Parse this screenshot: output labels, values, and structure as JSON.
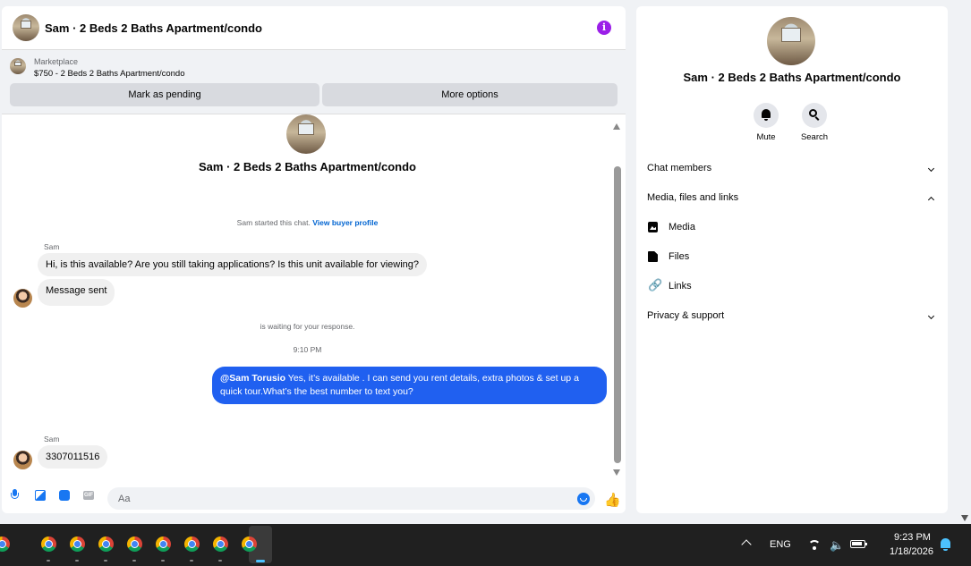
{
  "chat": {
    "title": "Sam · 2 Beds 2 Baths Apartment/condo",
    "info_icon_glyph": "i",
    "marketplace": {
      "label": "Marketplace",
      "listing": "$750 - 2 Beds 2 Baths Apartment/condo",
      "pending_button": "Mark as pending",
      "more_button": "More options"
    },
    "conversation_title": "Sam · 2 Beds 2 Baths Apartment/condo",
    "started_text": "Sam started this chat.",
    "buyer_profile_link": "View buyer profile",
    "messages": [
      {
        "sender": "Sam",
        "text": "Hi, is this available? Are you still taking applications? Is this unit available for viewing?"
      },
      {
        "text": "Message sent"
      }
    ],
    "waiting_text": "is waiting for your response.",
    "timestamp": "9:10 PM",
    "outgoing_mention": "@Sam Torusio",
    "outgoing_text": " Yes, it’s available .  I can send you rent details, extra photos & set up a quick tour.What’s the best number to text you?",
    "reply_sender": "Sam",
    "reply_text": "3307011516",
    "composer_placeholder": "Aa",
    "composer_icons": [
      "mic-icon",
      "photo-icon",
      "sticker-icon",
      "gif-icon",
      "emoji-icon",
      "like-icon"
    ],
    "gif_label": "GIF"
  },
  "details": {
    "title": "Sam · 2 Beds 2 Baths Apartment/condo",
    "mute_label": "Mute",
    "search_label": "Search",
    "chat_members": "Chat members",
    "media_files_links": "Media, files and links",
    "media": "Media",
    "files": "Files",
    "links": "Links",
    "privacy_support": "Privacy & support"
  },
  "taskbar": {
    "app_count": 9,
    "language": "ENG",
    "time": "9:23 PM",
    "date": "1/18/2026",
    "accent": "#4cc2ff"
  },
  "colors": {
    "messenger_blue": "#1877f2",
    "outgoing_bubble": "#2060f0",
    "info_purple": "#9b1fe8"
  }
}
